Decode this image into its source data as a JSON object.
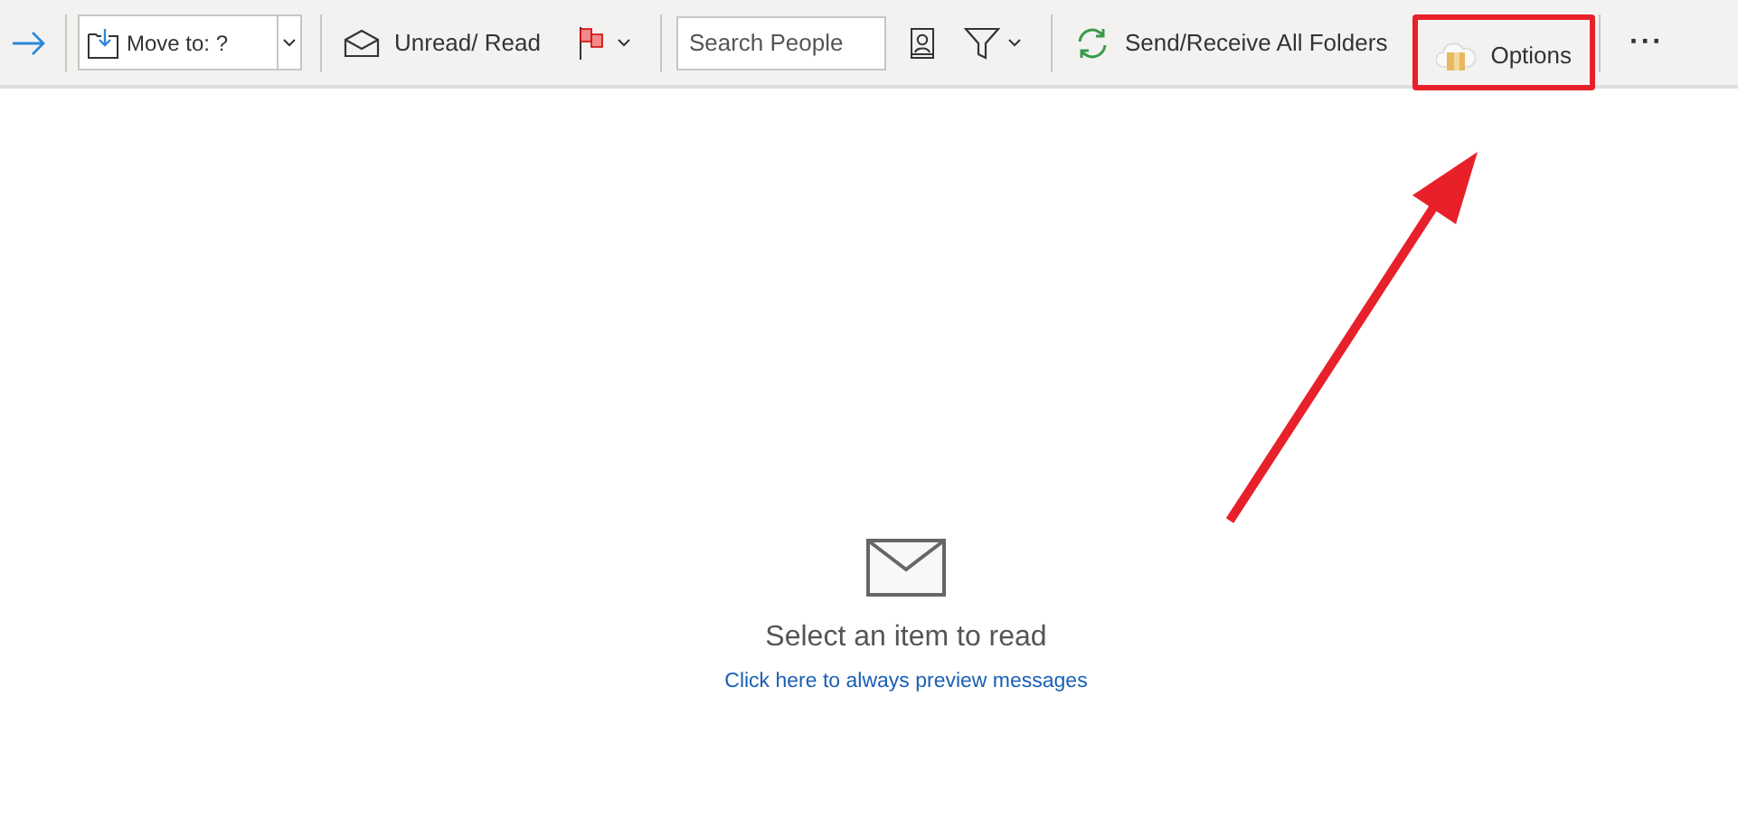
{
  "toolbar": {
    "move_to": {
      "value": "Move to: ?"
    },
    "unread_read": {
      "label": "Unread/ Read"
    },
    "search": {
      "placeholder": "Search People"
    },
    "send_receive": {
      "label": "Send/Receive All Folders"
    },
    "options": {
      "label": "Options"
    },
    "more": {
      "label": "···"
    }
  },
  "reading_pane": {
    "message": "Select an item to read",
    "link": "Click here to always preview messages"
  }
}
